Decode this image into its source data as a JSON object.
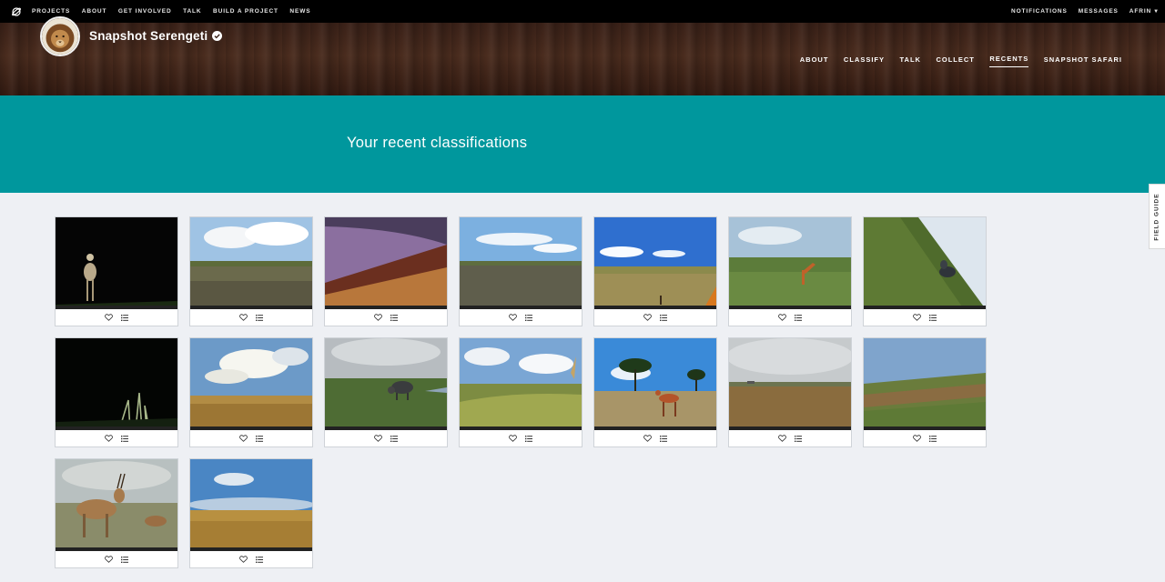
{
  "topnav": {
    "left": [
      "PROJECTS",
      "ABOUT",
      "GET INVOLVED",
      "TALK",
      "BUILD A PROJECT",
      "NEWS"
    ],
    "right": [
      "NOTIFICATIONS",
      "MESSAGES",
      "AFRIN"
    ]
  },
  "project": {
    "title": "Snapshot Serengeti",
    "nav": [
      {
        "label": "ABOUT",
        "active": false
      },
      {
        "label": "CLASSIFY",
        "active": false
      },
      {
        "label": "TALK",
        "active": false
      },
      {
        "label": "COLLECT",
        "active": false
      },
      {
        "label": "RECENTS",
        "active": true
      },
      {
        "label": "SNAPSHOT SAFARI",
        "active": false
      }
    ]
  },
  "page": {
    "title": "Your recent classifications"
  },
  "field_guide": "FIELD GUIDE",
  "colors": {
    "teal": "#00979d",
    "topbar": "#000000",
    "header_wood": "#3f2419"
  },
  "thumbnails": [
    {
      "scene": "night-antelope"
    },
    {
      "scene": "plains-cloudy"
    },
    {
      "scene": "purple-dusk"
    },
    {
      "scene": "plains-blue"
    },
    {
      "scene": "plains-bright"
    },
    {
      "scene": "green-giraffe"
    },
    {
      "scene": "tilted-buffalo"
    },
    {
      "scene": "night-grass"
    },
    {
      "scene": "golden-clouds"
    },
    {
      "scene": "gray-wildebeest"
    },
    {
      "scene": "tall-grass"
    },
    {
      "scene": "impala-acacia"
    },
    {
      "scene": "overcast-plain"
    },
    {
      "scene": "green-slope"
    },
    {
      "scene": "gazelle-closeup"
    },
    {
      "scene": "dry-grass"
    }
  ]
}
